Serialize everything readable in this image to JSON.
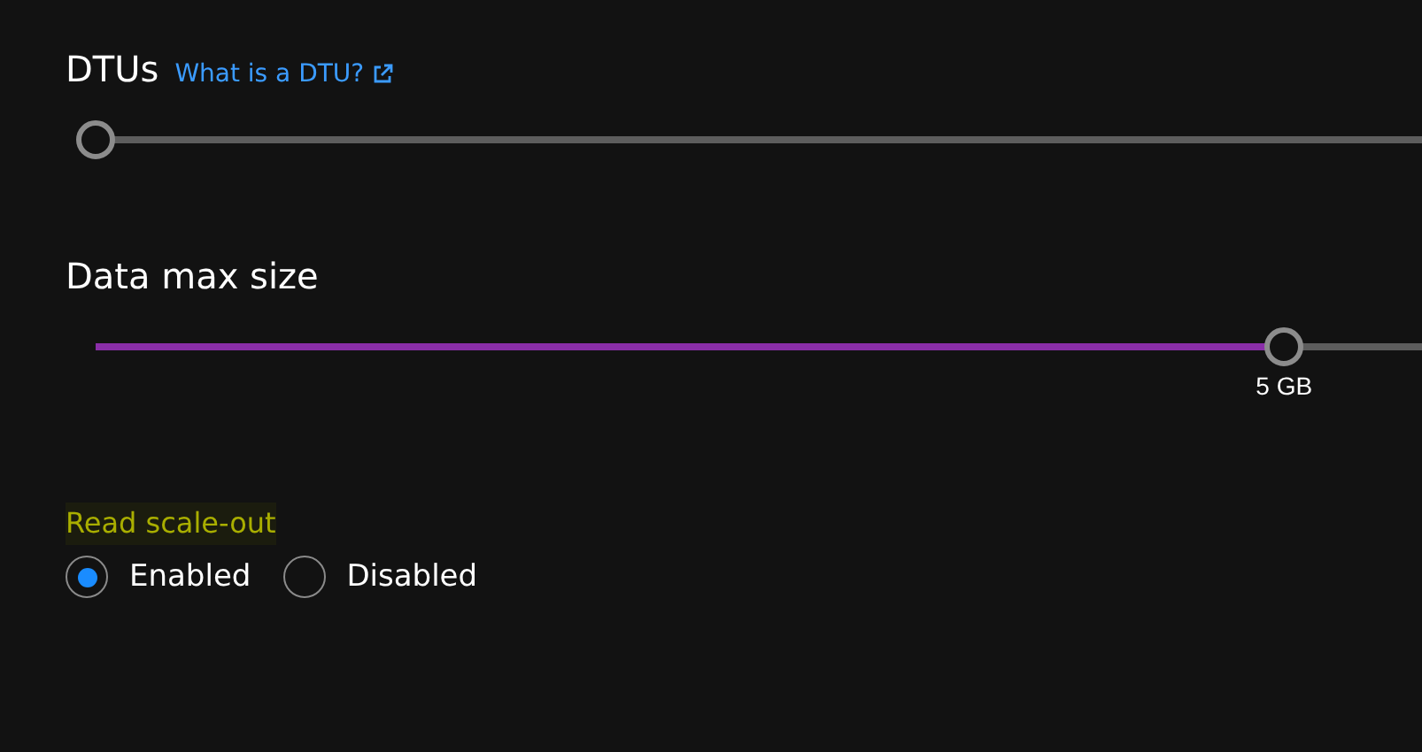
{
  "sections": [
    {
      "kind": "slider",
      "label": "DTUs",
      "link": "What is a DTU?",
      "level": 0
    },
    {
      "kind": "slider",
      "label": "Data max size",
      "level": 0.896,
      "reading": "5 GB"
    },
    {
      "kind": "radio",
      "label": "Read scale-out",
      "options": [
        {
          "label": "Enabled",
          "selected": true
        },
        {
          "label": "Disabled",
          "selected": false
        }
      ]
    }
  ]
}
